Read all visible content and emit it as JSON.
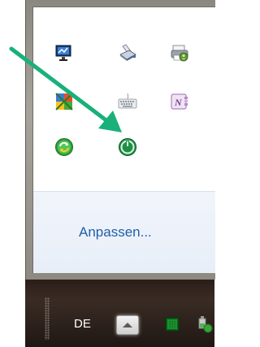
{
  "flyout": {
    "customize_label": "Anpassen...",
    "icons": [
      {
        "name": "network-monitor-icon",
        "row": 1,
        "col": 1
      },
      {
        "name": "printer-scanner-icon",
        "row": 1,
        "col": 2
      },
      {
        "name": "print-queue-icon",
        "row": 1,
        "col": 3
      },
      {
        "name": "windows-color-icon",
        "row": 2,
        "col": 1
      },
      {
        "name": "keyboard-icon",
        "row": 2,
        "col": 2
      },
      {
        "name": "onenote-icon",
        "row": 2,
        "col": 3
      },
      {
        "name": "sync-green-icon",
        "row": 3,
        "col": 1
      },
      {
        "name": "power-green-icon",
        "row": 3,
        "col": 2
      }
    ]
  },
  "taskbar": {
    "language": "DE",
    "show_hidden_icon": "chevron-up-icon",
    "tray_icons": [
      "green-square-icon",
      "battery-power-icon"
    ]
  },
  "annotation": {
    "arrow_color": "#19b07a"
  }
}
